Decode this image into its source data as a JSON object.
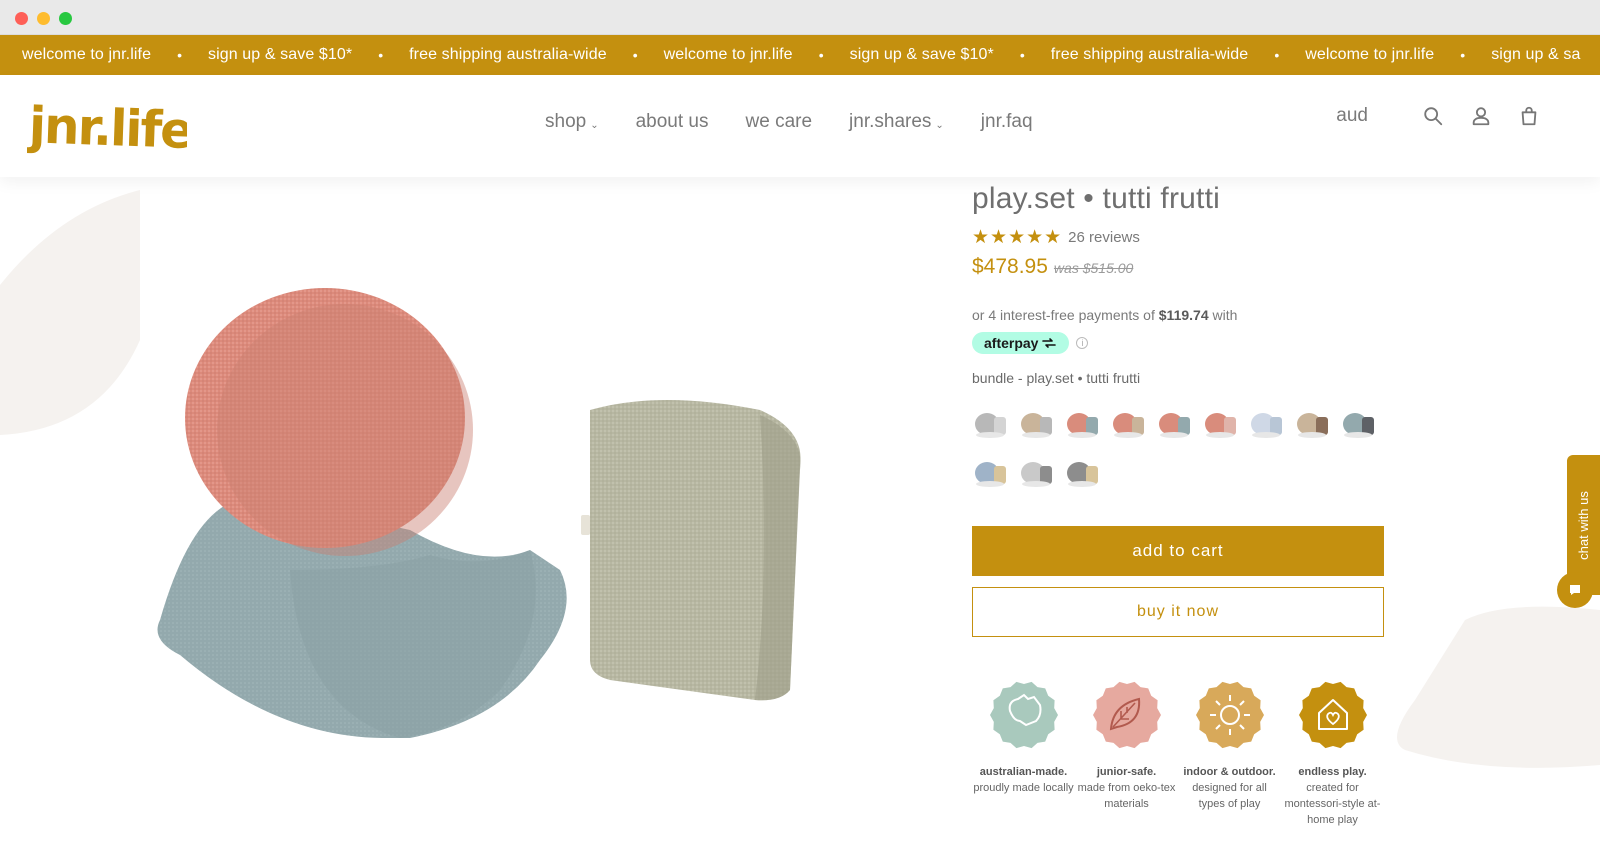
{
  "ticker": {
    "items": [
      "welcome to jnr.life",
      "sign up & save $10*",
      "free shipping australia-wide",
      "welcome to jnr.life",
      "sign up & save $10*",
      "free shipping australia-wide",
      "welcome to jnr.life",
      "sign up & sa"
    ],
    "separator": "•"
  },
  "header": {
    "logo_text": "jnr.life",
    "nav": [
      {
        "label": "shop",
        "has_dropdown": true
      },
      {
        "label": "about us",
        "has_dropdown": false
      },
      {
        "label": "we care",
        "has_dropdown": false
      },
      {
        "label": "jnr.shares",
        "has_dropdown": true
      },
      {
        "label": "jnr.faq",
        "has_dropdown": false
      }
    ],
    "currency": "aud",
    "icons": [
      "search-icon",
      "account-icon",
      "cart-icon"
    ]
  },
  "product": {
    "title": "play.set • tutti frutti",
    "stars": "★★★★★",
    "reviews": "26 reviews",
    "price": "$478.95",
    "was_price": "was $515.00",
    "afterpay": {
      "prefix": "or 4 interest-free payments of ",
      "amount": "$119.74",
      "suffix": " with",
      "badge": "afterpay"
    },
    "bundle_label": "bundle - play.set • tutti frutti",
    "add_to_cart": "add to cart",
    "buy_now": "buy it now",
    "features": [
      {
        "title": "australian-made.",
        "desc": "proudly made locally",
        "color": "#a9c9bd",
        "icon": "australia-icon"
      },
      {
        "title": "junior-safe.",
        "desc": "made from oeko-tex materials",
        "color": "#e6a99f",
        "icon": "leaf-icon"
      },
      {
        "title": "indoor & outdoor.",
        "desc": "designed for all types of play",
        "color": "#d8a95a",
        "icon": "sun-icon"
      },
      {
        "title": "endless play.",
        "desc": "created for montessori-style at-home play",
        "color": "#c4900f",
        "icon": "home-heart-icon"
      }
    ]
  },
  "chat": {
    "label": "chat with us"
  },
  "colors": {
    "brand": "#c4900f",
    "text": "#6f6f6f"
  }
}
